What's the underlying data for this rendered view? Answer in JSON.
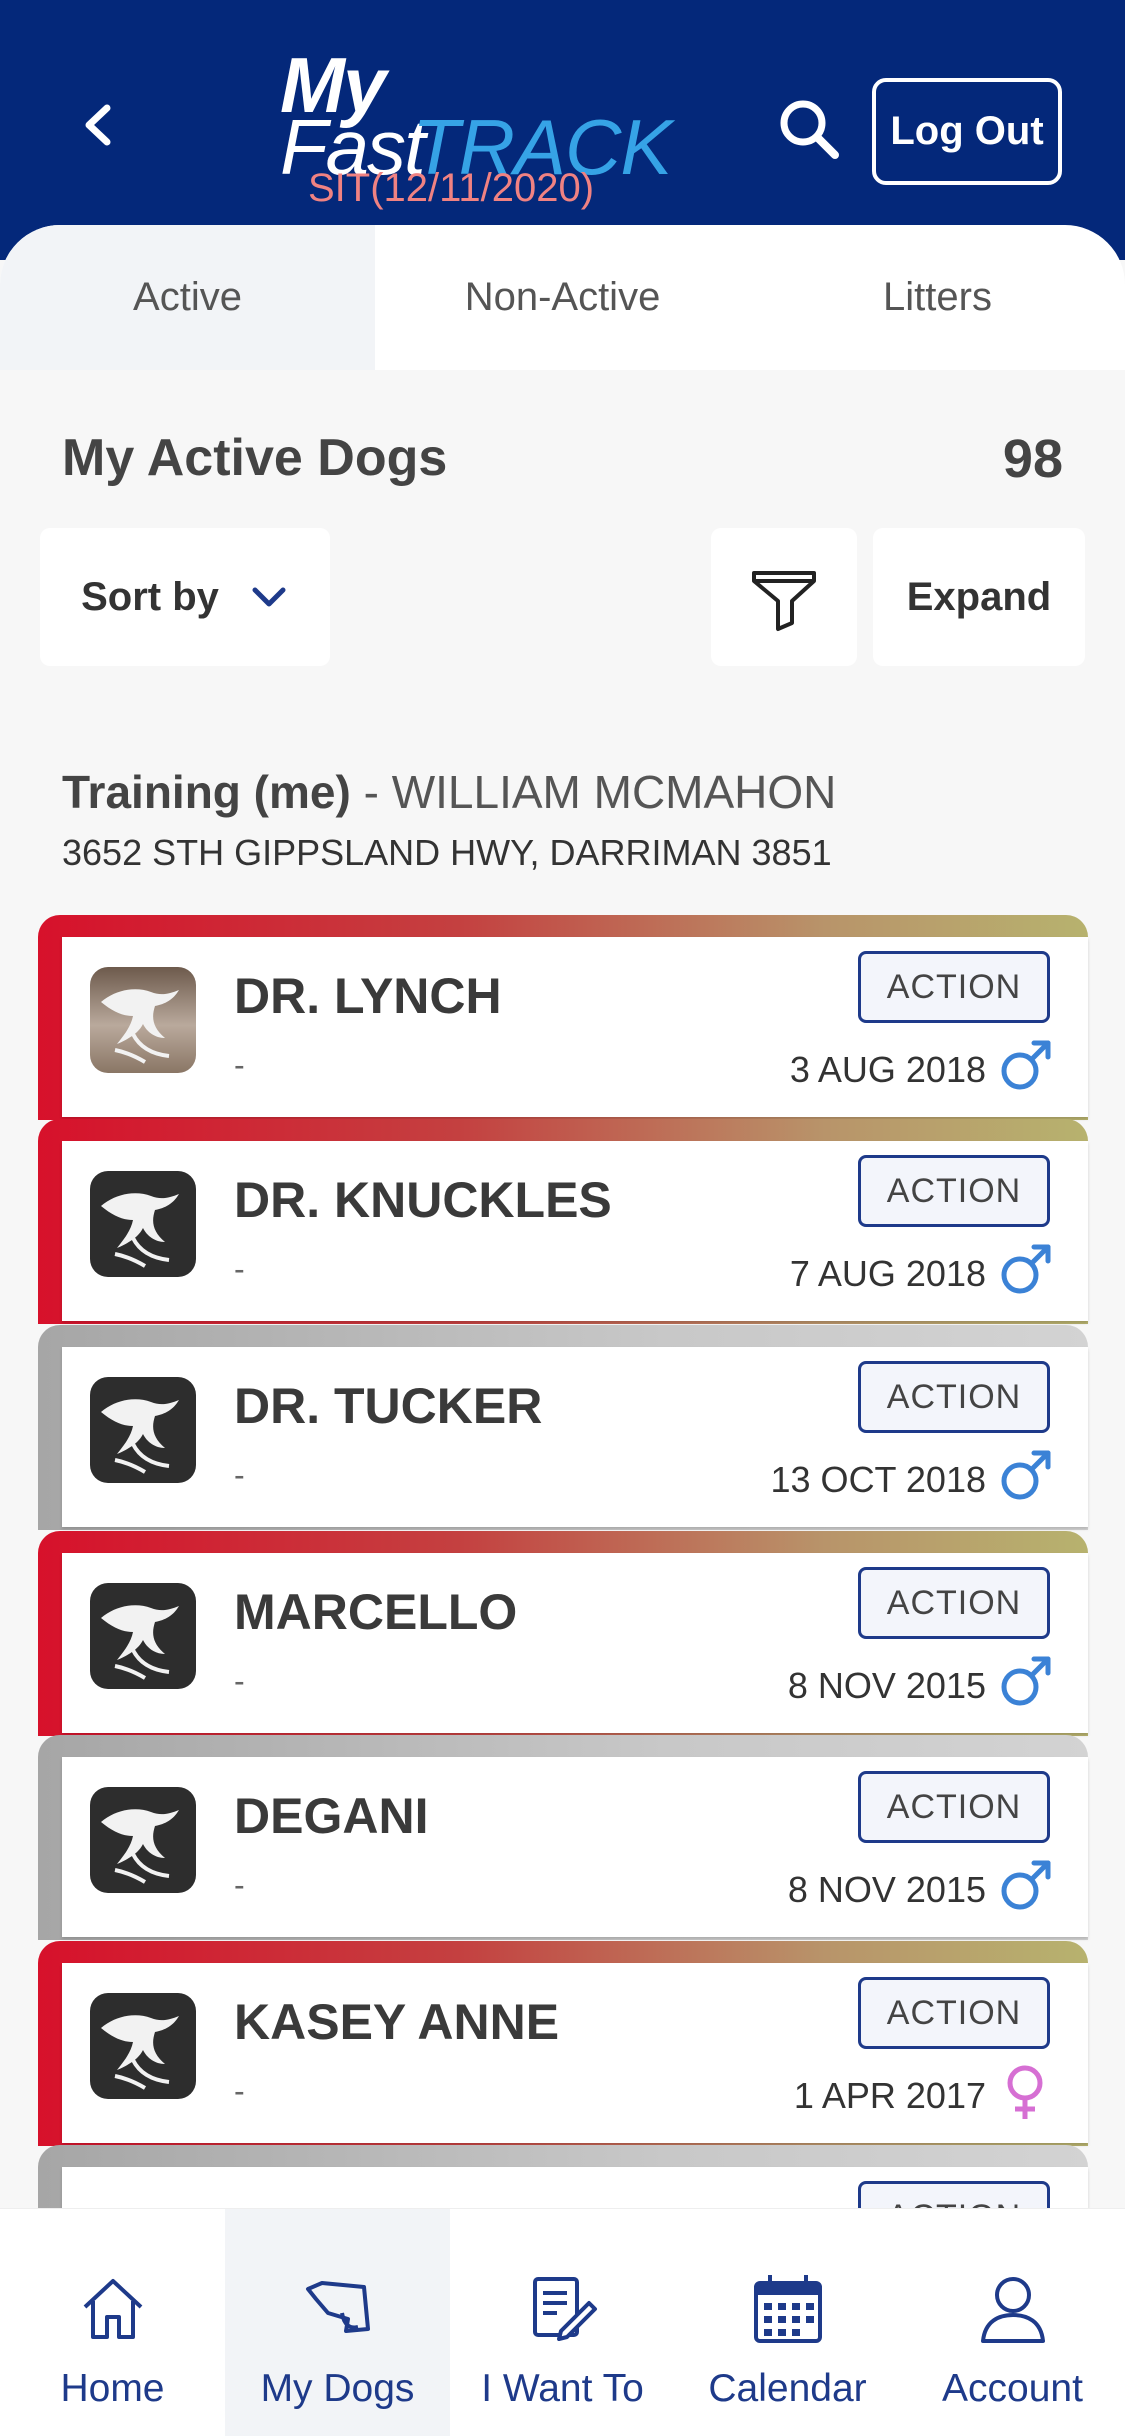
{
  "header": {
    "logo_my": "My",
    "logo_fast": "Fast",
    "logo_track": "TRACK",
    "environment": "SIT(12/11/2020)",
    "logout_label": "Log Out"
  },
  "tabs": [
    {
      "label": "Active"
    },
    {
      "label": "Non-Active"
    },
    {
      "label": "Litters"
    }
  ],
  "section": {
    "title": "My Active Dogs",
    "count": "98"
  },
  "controls": {
    "sort_label": "Sort by",
    "expand_label": "Expand"
  },
  "trainer": {
    "label": "Training (me)",
    "separator": " - ",
    "name": "WILLIAM MCMAHON",
    "address": "3652 STH GIPPSLAND HWY, DARRIMAN 3851"
  },
  "dogs": [
    {
      "name": "DR. LYNCH",
      "sub": "-",
      "dob": "3 AUG 2018",
      "sex": "male",
      "action": "ACTION",
      "status_color": "red"
    },
    {
      "name": "DR. KNUCKLES",
      "sub": "-",
      "dob": "7 AUG 2018",
      "sex": "male",
      "action": "ACTION",
      "status_color": "red"
    },
    {
      "name": "DR. TUCKER",
      "sub": "-",
      "dob": "13 OCT 2018",
      "sex": "male",
      "action": "ACTION",
      "status_color": "grey"
    },
    {
      "name": "MARCELLO",
      "sub": "-",
      "dob": "8 NOV 2015",
      "sex": "male",
      "action": "ACTION",
      "status_color": "red"
    },
    {
      "name": "DEGANI",
      "sub": "-",
      "dob": "8 NOV 2015",
      "sex": "male",
      "action": "ACTION",
      "status_color": "grey"
    },
    {
      "name": "KASEY ANNE",
      "sub": "-",
      "dob": "1 APR 2017",
      "sex": "female",
      "action": "ACTION",
      "status_color": "red"
    },
    {
      "action": "ACTION",
      "status_color": "grey"
    }
  ],
  "colors": {
    "header_bg": "#04287a",
    "accent_blue": "#1e3a8a",
    "track_blue": "#36a3e6",
    "male_blue": "#3b82d6",
    "female_pink": "#d66fd3",
    "status_red": "#d7112b",
    "status_grey": "#a6a6a6"
  },
  "bottom_nav": [
    {
      "label": "Home",
      "icon": "home-icon"
    },
    {
      "label": "My Dogs",
      "icon": "dog-icon"
    },
    {
      "label": "I Want To",
      "icon": "edit-document-icon"
    },
    {
      "label": "Calendar",
      "icon": "calendar-icon"
    },
    {
      "label": "Account",
      "icon": "account-icon"
    }
  ]
}
